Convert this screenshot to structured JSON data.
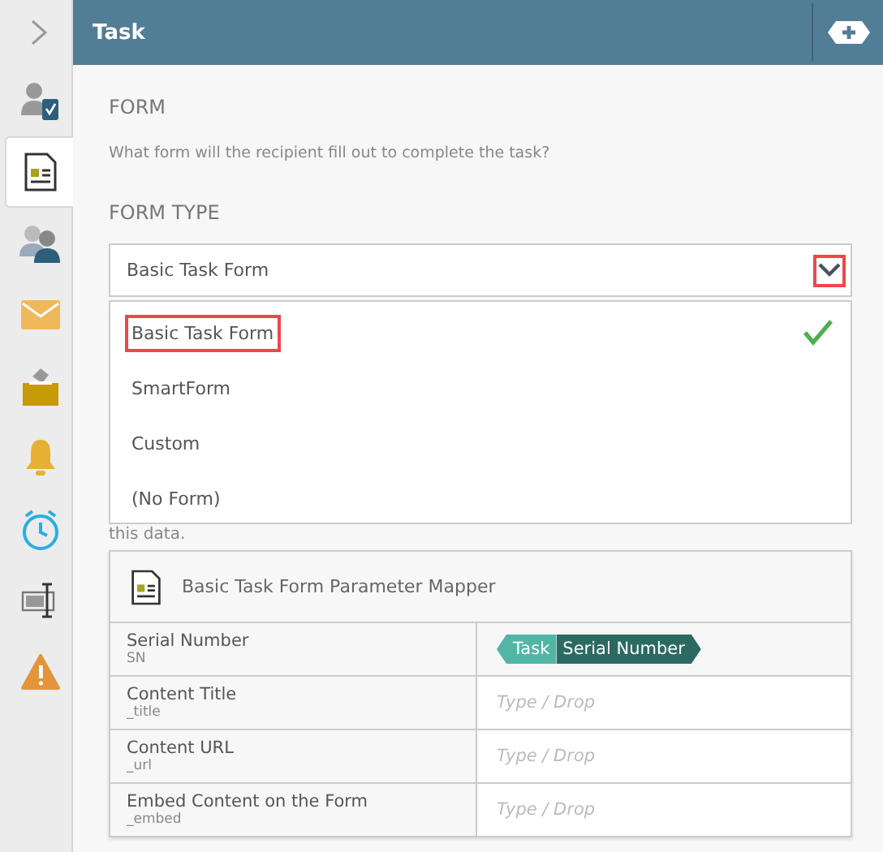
{
  "sidebar": {
    "items": [
      {
        "kind": "user-task",
        "selected": false
      },
      {
        "kind": "form",
        "selected": true
      },
      {
        "kind": "users",
        "selected": false
      },
      {
        "kind": "email",
        "selected": false
      },
      {
        "kind": "inbox",
        "selected": false
      },
      {
        "kind": "bell",
        "selected": false
      },
      {
        "kind": "timer",
        "selected": false
      },
      {
        "kind": "field",
        "selected": false
      },
      {
        "kind": "warning",
        "selected": false
      }
    ]
  },
  "header": {
    "title": "Task"
  },
  "form_section": {
    "heading": "FORM",
    "description": "What form will the recipient fill out to complete the task?",
    "type_heading": "FORM TYPE",
    "hidden_text": "this data."
  },
  "select": {
    "value": "Basic Task Form",
    "expanded": true,
    "chevron_highlighted": true
  },
  "options": [
    {
      "label": "Basic Task Form",
      "selected": true,
      "highlighted": true
    },
    {
      "label": "SmartForm",
      "selected": false,
      "highlighted": false
    },
    {
      "label": "Custom",
      "selected": false,
      "highlighted": false
    },
    {
      "label": "(No Form)",
      "selected": false,
      "highlighted": false
    }
  ],
  "mapper": {
    "title": "Basic Task Form Parameter Mapper",
    "rows": [
      {
        "name": "Serial Number",
        "key": "SN",
        "value": {
          "kind": "token",
          "source": "Task",
          "field": "Serial Number"
        }
      },
      {
        "name": "Content Title",
        "key": "_title",
        "value": {
          "kind": "placeholder",
          "placeholder": "Type / Drop"
        }
      },
      {
        "name": "Content URL",
        "key": "_url",
        "value": {
          "kind": "placeholder",
          "placeholder": "Type / Drop"
        }
      },
      {
        "name": "Embed Content on the Form",
        "key": "_embed",
        "value": {
          "kind": "placeholder",
          "placeholder": "Type / Drop"
        }
      }
    ]
  }
}
